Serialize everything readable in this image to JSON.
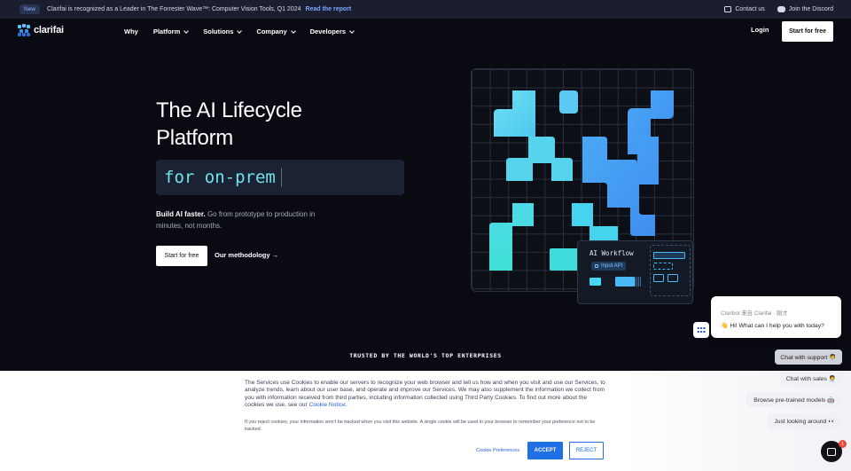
{
  "announcement": {
    "tag": "New",
    "message": "Clarifai is recognized as a Leader in The Forrester Wave™: Computer Vision Tools, Q1 2024",
    "link": "Read the report",
    "contact": "Contact us",
    "discord": "Join the Discord"
  },
  "nav": {
    "brand": "clarifai",
    "items": [
      {
        "label": "Why",
        "dropdown": false
      },
      {
        "label": "Platform",
        "dropdown": true
      },
      {
        "label": "Solutions",
        "dropdown": true
      },
      {
        "label": "Company",
        "dropdown": true
      },
      {
        "label": "Developers",
        "dropdown": true
      }
    ],
    "login": "Login",
    "cta": "Start for free"
  },
  "hero": {
    "title_line1": "The AI Lifecycle",
    "title_line2": "Platform",
    "typed": "for on-prem",
    "sub_bold": "Build AI faster.",
    "sub_rest": " Go from prototype to production in minutes, not months.",
    "cta": "Start for free",
    "link": "Our methodology →"
  },
  "workflow": {
    "title": "AI Workflow",
    "chip": "Input API"
  },
  "trusted": "TRUSTED BY THE WORLD'S TOP ENTERPRISES",
  "cookie": {
    "text": "The Services use Cookies to enable our servers to recognize your web browser and tell us how and when you visit and use our Services, to analyze trends, learn about our user base, and operate and improve our Services. We may also supplement the information we collect from you with information received from third parties, including information collected using Third Party Cookies. To find out more about the cookies we use, see our ",
    "notice_link": "Cookie Notice.",
    "reject_note": "If you reject cookies, your information won't be tracked when you visit this website. A single cookie will be used in your browser to remember your preference not to be tracked.",
    "preferences": "Cookie Preferences",
    "accept": "ACCEPT",
    "reject": "REJECT"
  },
  "chat": {
    "from": "Claribot 来自 Clarifai · 刚才",
    "message": "👋 Hi! What can I help you with today?",
    "quick_replies": [
      "Chat with support 🧑‍💼",
      "Chat with sales 🧑‍💼",
      "Browse pre-trained models 🤖",
      "Just looking around 👀"
    ],
    "unread": "1"
  },
  "colors": {
    "background": "#0a0b12",
    "accent_cyan": "#46d7f2",
    "accent_blue": "#4bb8f6",
    "button_blue": "#1f6fe5"
  }
}
